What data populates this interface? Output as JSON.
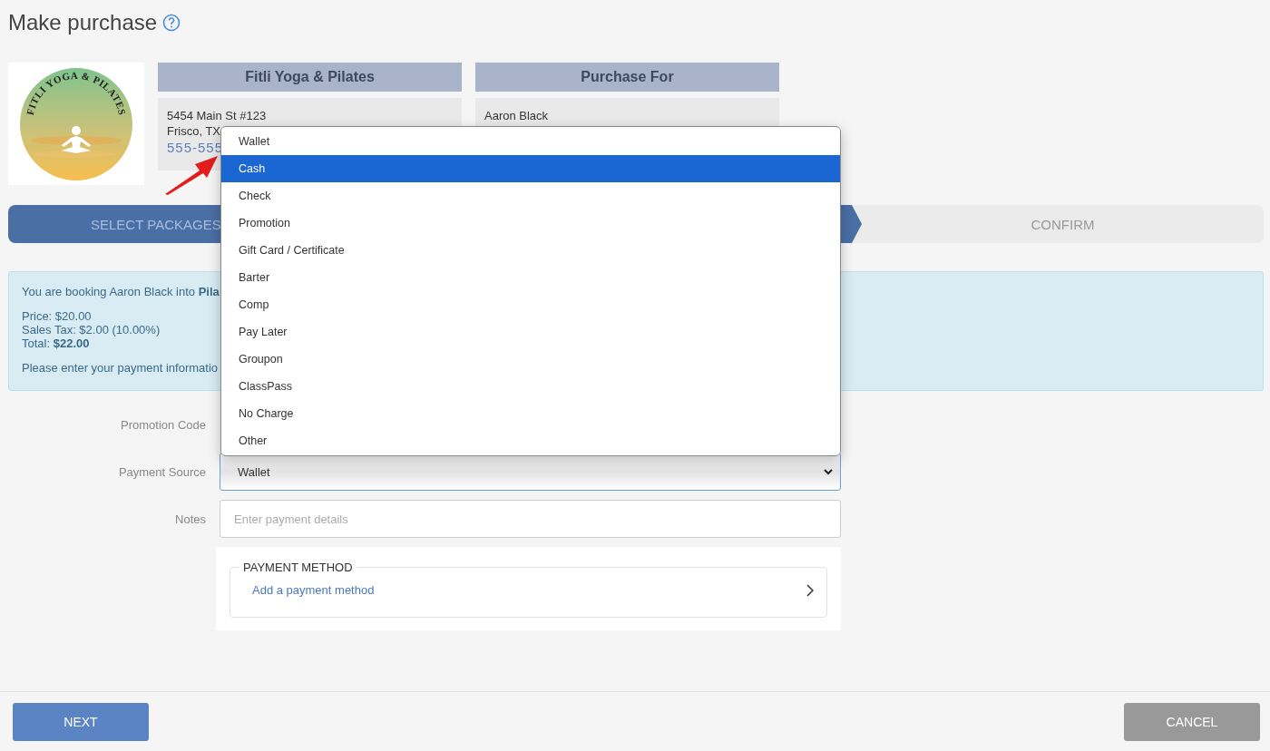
{
  "title": "Make purchase",
  "business": {
    "logo_text": "FITLI YOGA & PILATES",
    "name": "Fitli Yoga & Pilates",
    "address_line": "5454 Main St #123",
    "city": "Frisco, TX",
    "phone": "555-555"
  },
  "purchase_for": {
    "heading": "Purchase For",
    "name": "Aaron Black"
  },
  "steps": [
    {
      "label": "SELECT PACKAGES",
      "completed": true
    },
    {
      "label": "CONFIRM",
      "completed": false
    }
  ],
  "info": {
    "booking": "You are booking Aaron Black into **Pila**",
    "price": "Price: $20.00",
    "tax": "Sales Tax: $2.00 (10.00%)",
    "total": "Total: **$22.00**",
    "prompt": "Please enter your payment informatio"
  },
  "form": {
    "promotion_code_label": "Promotion Code",
    "payment_source": {
      "label": "Payment Source",
      "value": "Wallet",
      "open": true
    },
    "notes": {
      "label": "Notes",
      "placeholder": "Enter payment details"
    }
  },
  "options": [
    {
      "label": "Wallet",
      "selected": false
    },
    {
      "label": "Cash",
      "selected": true
    },
    {
      "label": "Check",
      "selected": false
    },
    {
      "label": "Promotion",
      "selected": false
    },
    {
      "label": "Gift Card / Certificate",
      "selected": false
    },
    {
      "label": "Barter",
      "selected": false
    },
    {
      "label": "Comp",
      "selected": false
    },
    {
      "label": "Pay Later",
      "selected": false
    },
    {
      "label": "Groupon",
      "selected": false
    },
    {
      "label": "ClassPass",
      "selected": false
    },
    {
      "label": "No Charge",
      "selected": false
    },
    {
      "label": "Other",
      "selected": false
    }
  ],
  "payment_method": {
    "legend": "PAYMENT METHOD",
    "link": "Add a payment method"
  },
  "buttons": [
    {
      "label": "NEXT",
      "kind": "primary"
    },
    {
      "label": "CANCEL",
      "kind": "secondary"
    }
  ]
}
